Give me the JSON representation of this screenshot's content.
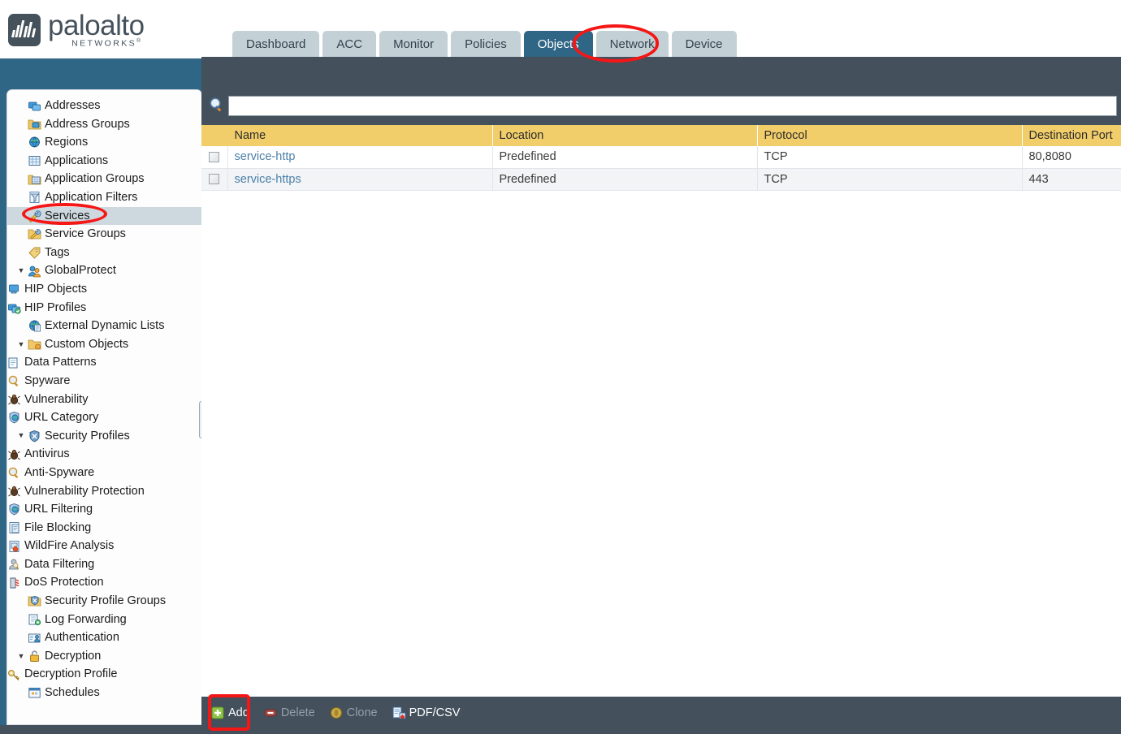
{
  "brand": {
    "name": "paloalto",
    "tagline": "NETWORKS",
    "trademark": "®",
    "logo_icon": "paloalto-waveform-logo"
  },
  "colors": {
    "teal": "#2f6585",
    "slate": "#44505c",
    "header_yellow": "#f2ce6b",
    "link_blue": "#4a7fa8",
    "annotation_red": "#f51616",
    "selected_row": "#cdd8df"
  },
  "tabs": [
    {
      "label": "Dashboard",
      "active": false
    },
    {
      "label": "ACC",
      "active": false
    },
    {
      "label": "Monitor",
      "active": false
    },
    {
      "label": "Policies",
      "active": false
    },
    {
      "label": "Objects",
      "active": true
    },
    {
      "label": "Network",
      "active": false
    },
    {
      "label": "Device",
      "active": false
    }
  ],
  "sidebar": {
    "items": [
      {
        "label": "Addresses",
        "icon": "addresses-icon",
        "indent": 0,
        "twisty": "",
        "selected": false
      },
      {
        "label": "Address Groups",
        "icon": "address-groups-icon",
        "indent": 0,
        "twisty": "",
        "selected": false
      },
      {
        "label": "Regions",
        "icon": "regions-icon",
        "indent": 0,
        "twisty": "",
        "selected": false
      },
      {
        "label": "Applications",
        "icon": "applications-icon",
        "indent": 0,
        "twisty": "",
        "selected": false
      },
      {
        "label": "Application Groups",
        "icon": "application-groups-icon",
        "indent": 0,
        "twisty": "",
        "selected": false
      },
      {
        "label": "Application Filters",
        "icon": "application-filters-icon",
        "indent": 0,
        "twisty": "",
        "selected": false
      },
      {
        "label": "Services",
        "icon": "services-icon",
        "indent": 0,
        "twisty": "",
        "selected": true
      },
      {
        "label": "Service Groups",
        "icon": "service-groups-icon",
        "indent": 0,
        "twisty": "",
        "selected": false
      },
      {
        "label": "Tags",
        "icon": "tags-icon",
        "indent": 0,
        "twisty": "",
        "selected": false
      },
      {
        "label": "GlobalProtect",
        "icon": "globalprotect-icon",
        "indent": 0,
        "twisty": "▼",
        "selected": false
      },
      {
        "label": "HIP Objects",
        "icon": "hip-objects-icon",
        "indent": 1,
        "twisty": "",
        "selected": false
      },
      {
        "label": "HIP Profiles",
        "icon": "hip-profiles-icon",
        "indent": 1,
        "twisty": "",
        "selected": false
      },
      {
        "label": "External Dynamic Lists",
        "icon": "external-dynamic-lists-icon",
        "indent": 0,
        "twisty": "",
        "selected": false
      },
      {
        "label": "Custom Objects",
        "icon": "custom-objects-icon",
        "indent": 0,
        "twisty": "▼",
        "selected": false
      },
      {
        "label": "Data Patterns",
        "icon": "data-patterns-icon",
        "indent": 1,
        "twisty": "",
        "selected": false
      },
      {
        "label": "Spyware",
        "icon": "spyware-icon",
        "indent": 1,
        "twisty": "",
        "selected": false
      },
      {
        "label": "Vulnerability",
        "icon": "vulnerability-icon",
        "indent": 1,
        "twisty": "",
        "selected": false
      },
      {
        "label": "URL Category",
        "icon": "url-category-icon",
        "indent": 1,
        "twisty": "",
        "selected": false
      },
      {
        "label": "Security Profiles",
        "icon": "security-profiles-icon",
        "indent": 0,
        "twisty": "▼",
        "selected": false
      },
      {
        "label": "Antivirus",
        "icon": "antivirus-icon",
        "indent": 1,
        "twisty": "",
        "selected": false
      },
      {
        "label": "Anti-Spyware",
        "icon": "anti-spyware-icon",
        "indent": 1,
        "twisty": "",
        "selected": false
      },
      {
        "label": "Vulnerability Protection",
        "icon": "vulnerability-protection-icon",
        "indent": 1,
        "twisty": "",
        "selected": false
      },
      {
        "label": "URL Filtering",
        "icon": "url-filtering-icon",
        "indent": 1,
        "twisty": "",
        "selected": false
      },
      {
        "label": "File Blocking",
        "icon": "file-blocking-icon",
        "indent": 1,
        "twisty": "",
        "selected": false
      },
      {
        "label": "WildFire Analysis",
        "icon": "wildfire-analysis-icon",
        "indent": 1,
        "twisty": "",
        "selected": false
      },
      {
        "label": "Data Filtering",
        "icon": "data-filtering-icon",
        "indent": 1,
        "twisty": "",
        "selected": false
      },
      {
        "label": "DoS Protection",
        "icon": "dos-protection-icon",
        "indent": 1,
        "twisty": "",
        "selected": false
      },
      {
        "label": "Security Profile Groups",
        "icon": "security-profile-groups-icon",
        "indent": 0,
        "twisty": "",
        "selected": false
      },
      {
        "label": "Log Forwarding",
        "icon": "log-forwarding-icon",
        "indent": 0,
        "twisty": "",
        "selected": false
      },
      {
        "label": "Authentication",
        "icon": "authentication-icon",
        "indent": 0,
        "twisty": "",
        "selected": false
      },
      {
        "label": "Decryption",
        "icon": "decryption-icon",
        "indent": 0,
        "twisty": "▼",
        "selected": false
      },
      {
        "label": "Decryption Profile",
        "icon": "decryption-profile-icon",
        "indent": 1,
        "twisty": "",
        "selected": false
      },
      {
        "label": "Schedules",
        "icon": "schedules-icon",
        "indent": 0,
        "twisty": "",
        "selected": false
      }
    ]
  },
  "search": {
    "value": "",
    "placeholder": "",
    "icon": "search-icon"
  },
  "table": {
    "columns": [
      "Name",
      "Location",
      "Protocol",
      "Destination Port"
    ],
    "rows": [
      {
        "name": "service-http",
        "location": "Predefined",
        "protocol": "TCP",
        "port": "80,8080"
      },
      {
        "name": "service-https",
        "location": "Predefined",
        "protocol": "TCP",
        "port": "443"
      }
    ]
  },
  "footer": {
    "buttons": [
      {
        "label": "Add",
        "icon": "plus-icon",
        "enabled": true
      },
      {
        "label": "Delete",
        "icon": "minus-icon",
        "enabled": false
      },
      {
        "label": "Clone",
        "icon": "clone-icon",
        "enabled": false
      },
      {
        "label": "PDF/CSV",
        "icon": "pdf-csv-icon",
        "enabled": true
      }
    ]
  }
}
